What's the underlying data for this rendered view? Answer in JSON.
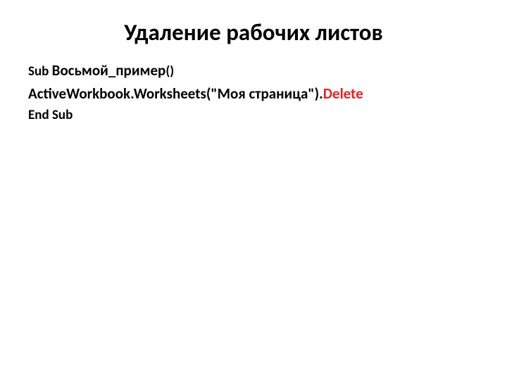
{
  "title": "Удаление рабочих листов",
  "code": {
    "line1": {
      "sub": "Sub ",
      "name": "Восьмой_пример",
      "parens": "()"
    },
    "line2": {
      "main": "ActiveWorkbook.Worksheets(\"Моя страница\").",
      "highlight": "Delete"
    },
    "line3": "End Sub"
  }
}
